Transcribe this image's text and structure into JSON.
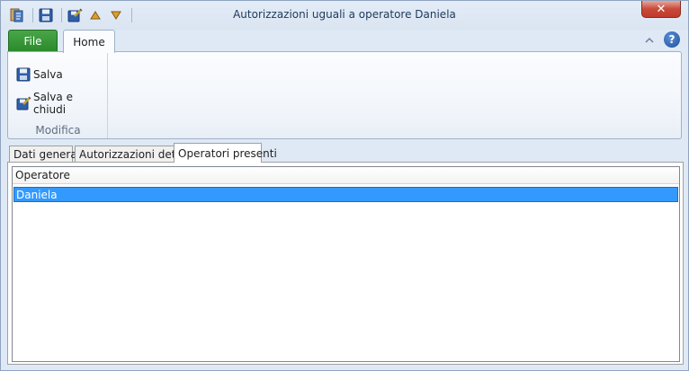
{
  "window": {
    "title": "Autorizzazioni uguali a operatore Daniela",
    "close_glyph": "✕"
  },
  "quick_access": [
    {
      "name": "app-icon"
    },
    {
      "name": "save-icon"
    },
    {
      "name": "save-close-icon"
    },
    {
      "name": "arrow-up-icon"
    },
    {
      "name": "arrow-down-icon"
    }
  ],
  "ribbon": {
    "file_tab": "File",
    "home_tab": "Home",
    "help_glyph": "?",
    "group": {
      "label": "Modifica",
      "buttons": [
        {
          "label": "Salva",
          "icon": "save-icon"
        },
        {
          "label": "Salva e chiudi",
          "icon": "save-close-icon"
        }
      ]
    }
  },
  "tabs": [
    {
      "label": "Dati generali",
      "active": false
    },
    {
      "label": "Autorizzazioni dettagli",
      "active": false
    },
    {
      "label": "Operatori presenti",
      "active": true
    }
  ],
  "grid": {
    "columns": [
      "Operatore"
    ],
    "rows": [
      {
        "operatore": "Daniela",
        "selected": true
      }
    ]
  },
  "colors": {
    "selection": "#3399ff",
    "file_tab": "#2a8a2a",
    "close_button": "#c74a3a"
  }
}
